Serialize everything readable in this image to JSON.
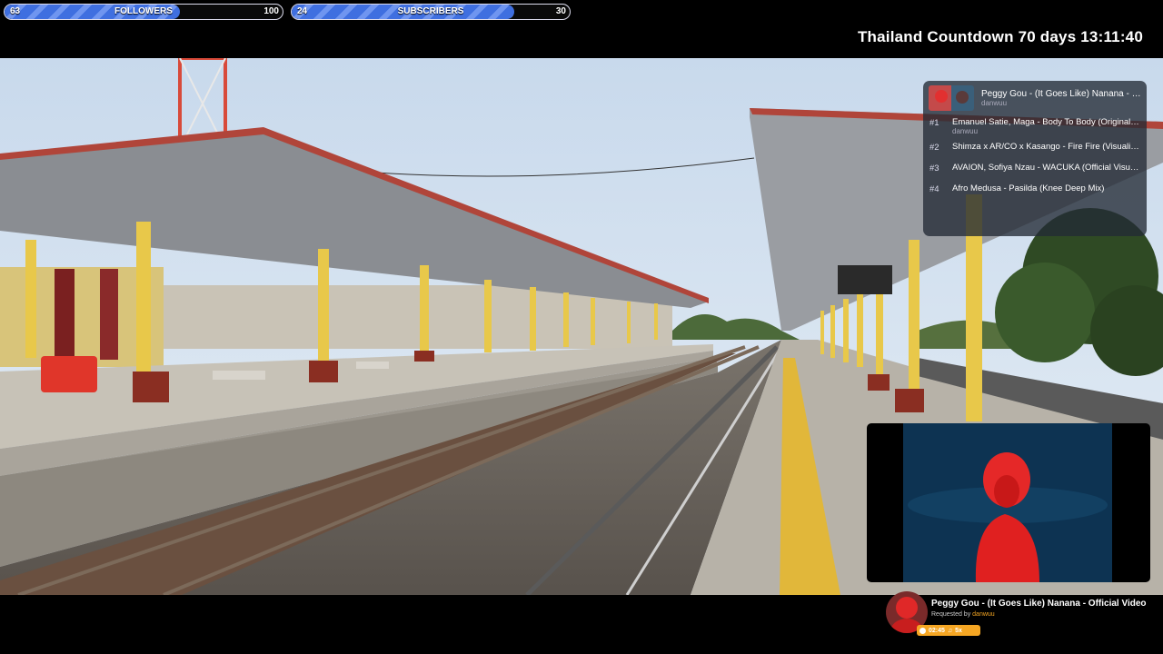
{
  "goals": [
    {
      "current": "63",
      "label": "FOLLOWERS",
      "target": "100",
      "progress": 0.63
    },
    {
      "current": "24",
      "label": "SUBSCRIBERS",
      "target": "30",
      "progress": 0.8
    }
  ],
  "countdown": "Thailand Countdown 70 days 13:11:40",
  "playlist": {
    "now_playing": {
      "title": "Peggy Gou - (It Goes Like) Nanana - Official Video",
      "user": "danwuu"
    },
    "queue": [
      {
        "num": "#1",
        "title": "Emanuel Satie, Maga - Body To Body (Original Mix)",
        "user": "danwuu"
      },
      {
        "num": "#2",
        "title": "Shimza x AR/CO x Kasango - Fire Fire (Visualizer)",
        "user": ""
      },
      {
        "num": "#3",
        "title": "AVAION, Sofiya Nzau - WACUKA (Official Visualizer)",
        "user": ""
      },
      {
        "num": "#4",
        "title": "Afro Medusa - Pasilda (Knee Deep Mix)",
        "user": ""
      }
    ]
  },
  "now_playing_bar": {
    "title": "Peggy Gou - (It Goes Like) Nanana - Official Video",
    "requested_prefix": "Requested by",
    "requested_by": "danwuu",
    "time": "02:45",
    "count": "5x"
  },
  "colors": {
    "goal_fill": "#3f6fe0",
    "accent": "#f5a623",
    "panel": "#232a34"
  }
}
